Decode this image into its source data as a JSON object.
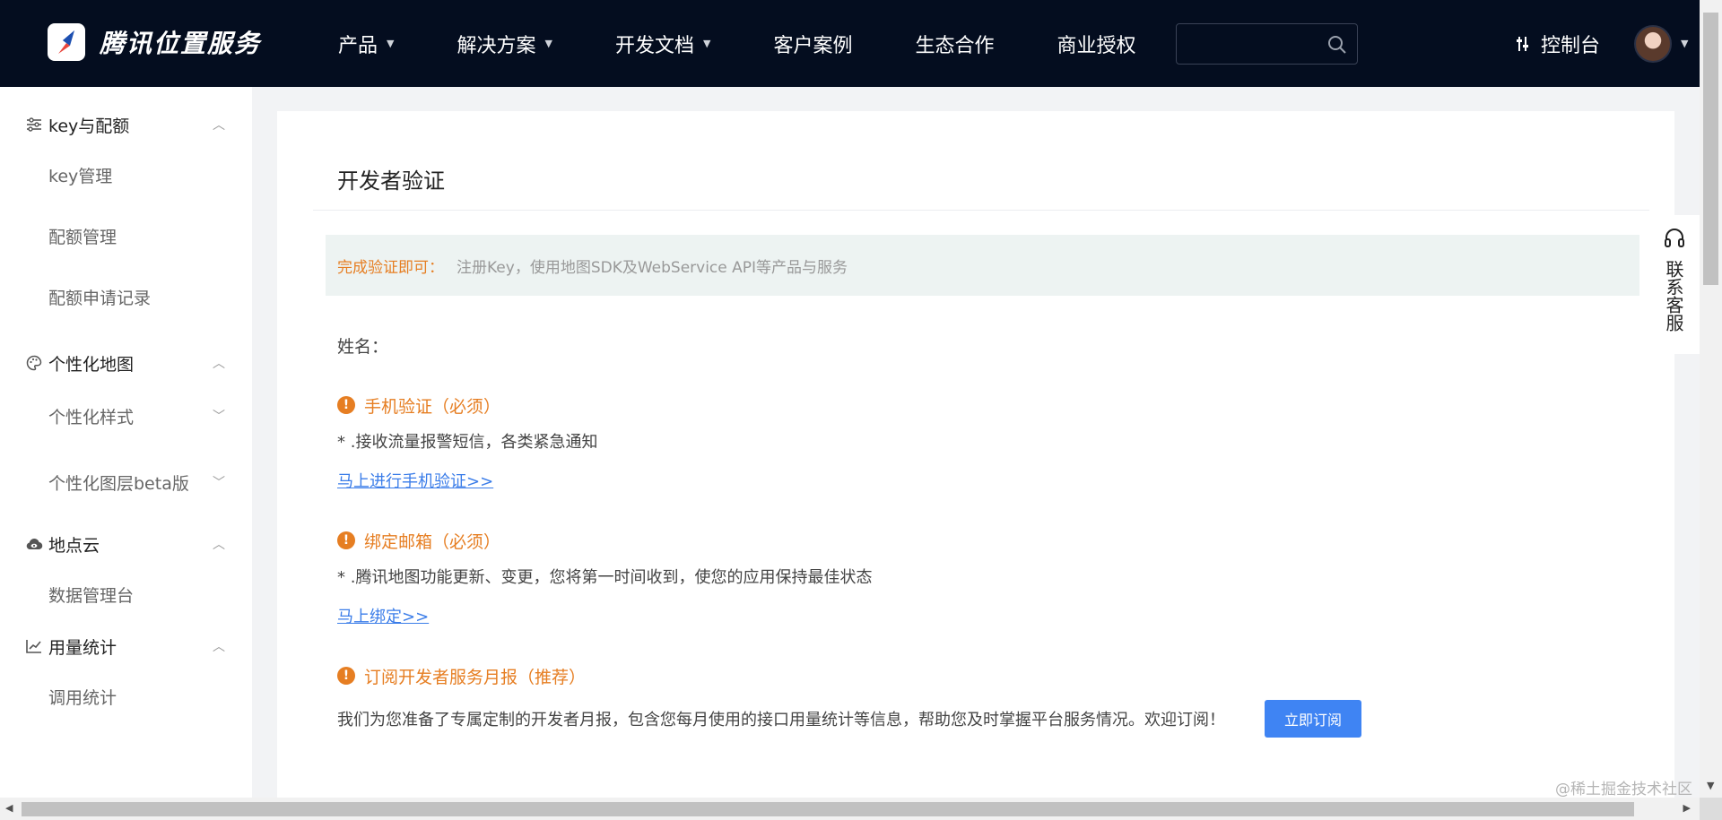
{
  "brand": {
    "name": "腾讯位置服务"
  },
  "nav": {
    "items": [
      {
        "label": "产品",
        "dropdown": true
      },
      {
        "label": "解决方案",
        "dropdown": true
      },
      {
        "label": "开发文档",
        "dropdown": true
      },
      {
        "label": "客户案例",
        "dropdown": false
      },
      {
        "label": "生态合作",
        "dropdown": false
      },
      {
        "label": "商业授权",
        "dropdown": false
      }
    ],
    "search_placeholder": "",
    "console_label": "控制台"
  },
  "sidebar": {
    "groups": [
      {
        "label": "key与配额",
        "icon": "sliders-icon",
        "items": [
          {
            "label": "key管理"
          },
          {
            "label": "配额管理"
          },
          {
            "label": "配额申请记录"
          }
        ]
      },
      {
        "label": "个性化地图",
        "icon": "palette-icon",
        "items": [
          {
            "label": "个性化样式"
          },
          {
            "label": "个性化图层beta版"
          }
        ]
      },
      {
        "label": "地点云",
        "icon": "cloud-eye-icon",
        "items": [
          {
            "label": "数据管理台"
          }
        ]
      },
      {
        "label": "用量统计",
        "icon": "line-chart-icon",
        "items": [
          {
            "label": "调用统计"
          }
        ]
      }
    ]
  },
  "main": {
    "title": "开发者验证",
    "notice": {
      "label": "完成验证即可：",
      "text": "注册Key，使用地图SDK及WebService API等产品与服务"
    },
    "name_label": "姓名：",
    "sections": [
      {
        "title": "手机验证（必须）",
        "desc": "* .接收流量报警短信，各类紧急通知",
        "link": "马上进行手机验证>>"
      },
      {
        "title": "绑定邮箱（必须）",
        "desc": "* .腾讯地图功能更新、变更，您将第一时间收到，使您的应用保持最佳状态",
        "link": "马上绑定>>"
      },
      {
        "title": "订阅开发者服务月报（推荐）",
        "desc": "我们为您准备了专属定制的开发者月报，包含您每月使用的接口用量统计等信息，帮助您及时掌握平台服务情况。欢迎订阅！",
        "button": "立即订阅"
      }
    ]
  },
  "customer_service": {
    "label": "联系客服"
  },
  "watermark": "@稀土掘金技术社区",
  "colors": {
    "nav_bg": "#040d1f",
    "accent_orange": "#e67e22",
    "link_blue": "#3b7de9",
    "button_blue": "#3f84f3"
  }
}
